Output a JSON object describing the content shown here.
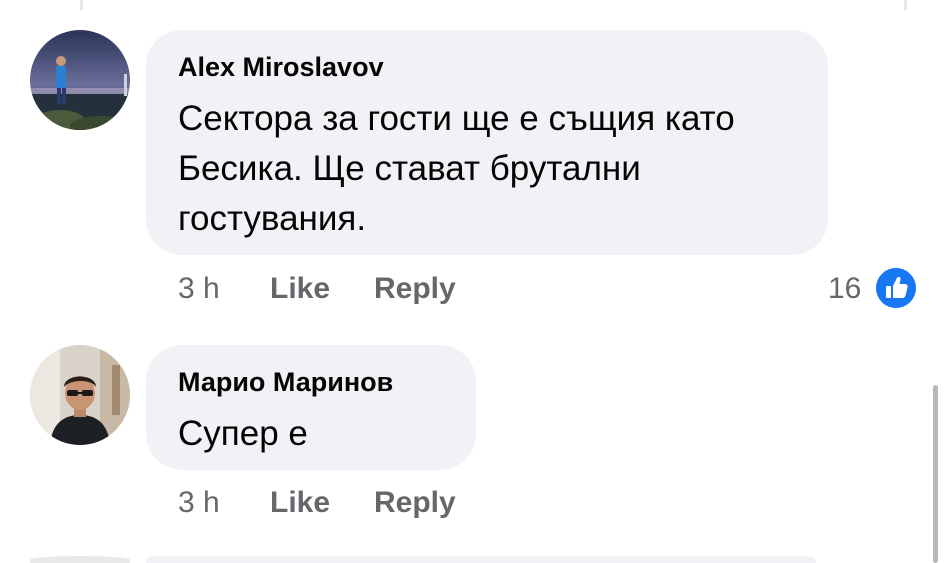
{
  "comments": [
    {
      "author": "Alex Miroslavov",
      "text_line1": "Сектора за гости ще е същия като",
      "text_line2": "Бесика. Ще стават брутални",
      "text_line3": "гостувания.",
      "time": "3 h",
      "like_label": "Like",
      "reply_label": "Reply",
      "reaction_count": "16",
      "reaction_icon": "thumbs-up-icon"
    },
    {
      "author": "Марио Маринов",
      "text_line1": "Супер е",
      "time": "3 h",
      "like_label": "Like",
      "reply_label": "Reply"
    }
  ],
  "colors": {
    "bubble": "#f0f2f5",
    "text": "#050505",
    "meta": "#65676b",
    "like_blue": "#1877f2"
  }
}
